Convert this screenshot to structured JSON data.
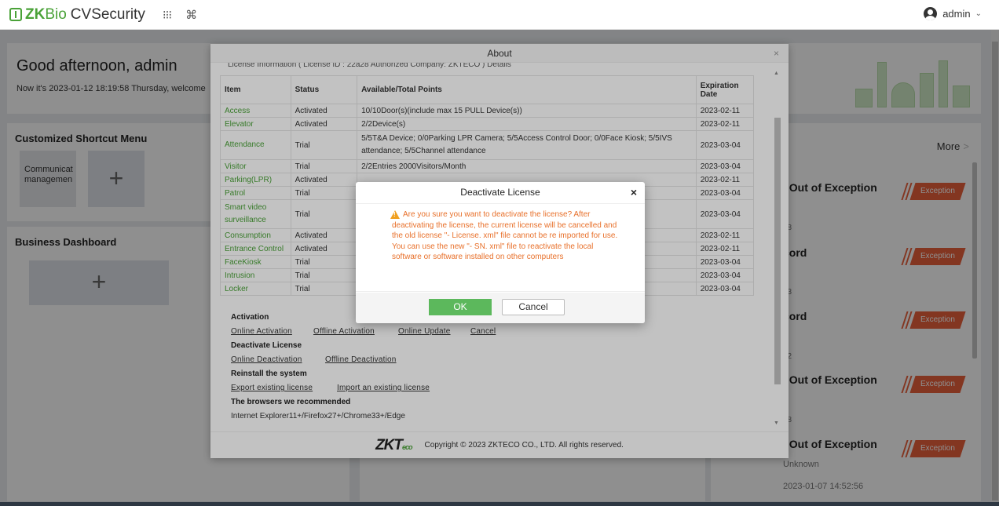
{
  "app": {
    "brand_zk": "ZK",
    "brand_bio": "Bio",
    "brand_cv": "CVSecurity",
    "user": "admin"
  },
  "home": {
    "greeting": "Good afternoon, admin",
    "now_text": "Now it's 2023-01-12 18:19:58 Thursday, welcome",
    "shortcut_title": "Customized Shortcut Menu",
    "shortcut_tile": "Communicat managemen",
    "add_symbol": "+",
    "dashboard_title": "Business Dashboard",
    "more": "More",
    "more_chevron": ">",
    "events": [
      {
        "title": "l Out of Exception",
        "sub": "58",
        "badge": "Exception"
      },
      {
        "title": "cord",
        "sub": "33",
        "badge": "Exception"
      },
      {
        "title": "cord",
        "sub": "02",
        "badge": "Exception"
      },
      {
        "title": "l Out of Exception",
        "sub": "48",
        "badge": "Exception"
      },
      {
        "title": "l Out of Exception",
        "sub": "Unknown",
        "badge": "Exception"
      }
    ],
    "last_time": "2023-01-07 14:52:56"
  },
  "about": {
    "title": "About",
    "close": "×",
    "license_info": "License Information ( License ID : 22a28   Authorized Company: ZKTECO ) Details",
    "headers": [
      "Item",
      "Status",
      "Available/Total Points",
      "Expiration Date"
    ],
    "rows": [
      {
        "item": "Access",
        "status": "Activated",
        "points": "10/10Door(s)(include max 15 PULL Device(s))",
        "date": "2023-02-11"
      },
      {
        "item": "Elevator",
        "status": "Activated",
        "points": "2/2Device(s)",
        "date": "2023-02-11"
      },
      {
        "item": "Attendance",
        "status": "Trial",
        "points": "5/5T&A Device; 0/0Parking LPR Camera; 5/5Access Control Door; 0/0Face Kiosk; 5/5IVS attendance; 5/5Channel attendance",
        "date": "2023-03-04"
      },
      {
        "item": "Visitor",
        "status": "Trial",
        "points": "2/2Entries 2000Visitors/Month",
        "date": "2023-03-04"
      },
      {
        "item": "Parking(LPR)",
        "status": "Activated",
        "points": "",
        "date": "2023-02-11"
      },
      {
        "item": "Patrol",
        "status": "Trial",
        "points": "",
        "date": "2023-03-04"
      },
      {
        "item": "Smart video surveillance",
        "status": "Trial",
        "points": "",
        "date": "2023-03-04"
      },
      {
        "item": "Consumption",
        "status": "Activated",
        "points": "",
        "date": "2023-02-11"
      },
      {
        "item": "Entrance Control",
        "status": "Activated",
        "points": "",
        "date": "2023-02-11"
      },
      {
        "item": "FaceKiosk",
        "status": "Trial",
        "points": "",
        "date": "2023-03-04"
      },
      {
        "item": "Intrusion",
        "status": "Trial",
        "points": "",
        "date": "2023-03-04"
      },
      {
        "item": "Locker",
        "status": "Trial",
        "points": "",
        "date": "2023-03-04"
      }
    ],
    "activation_title": "Activation",
    "online_activation": "Online Activation",
    "offline_activation": "Offline Activation",
    "online_update": "Online Update",
    "cancel_link": "Cancel",
    "deactivate_title": "Deactivate License",
    "online_deactivation": "Online Deactivation",
    "offline_deactivation": "Offline Deactivation",
    "reinstall_title": "Reinstall the system",
    "export_license": "Export existing license",
    "import_license": "Import an existing license",
    "browsers_title": "The browsers we recommended",
    "browsers": "Internet Explorer11+/Firefox27+/Chrome33+/Edge",
    "footer_logo": "ZKT",
    "footer_logo_eco": "eco",
    "copyright": "Copyright © 2023 ZKTECO CO., LTD. All rights reserved."
  },
  "modal": {
    "title": "Deactivate License",
    "close": "×",
    "message": "Are you sure you want to deactivate the license? After deactivating the license, the current license will be cancelled and the old license \"- License. xml\" file cannot be re imported for use. You can use the new \"- SN. xml\" file to reactivate the local software or software installed on other computers",
    "ok": "OK",
    "cancel": "Cancel"
  },
  "colors": {
    "brand_green": "#4aa238",
    "warning": "#e8702a",
    "ok_button": "#5cb85c",
    "exception": "#e8603c"
  }
}
